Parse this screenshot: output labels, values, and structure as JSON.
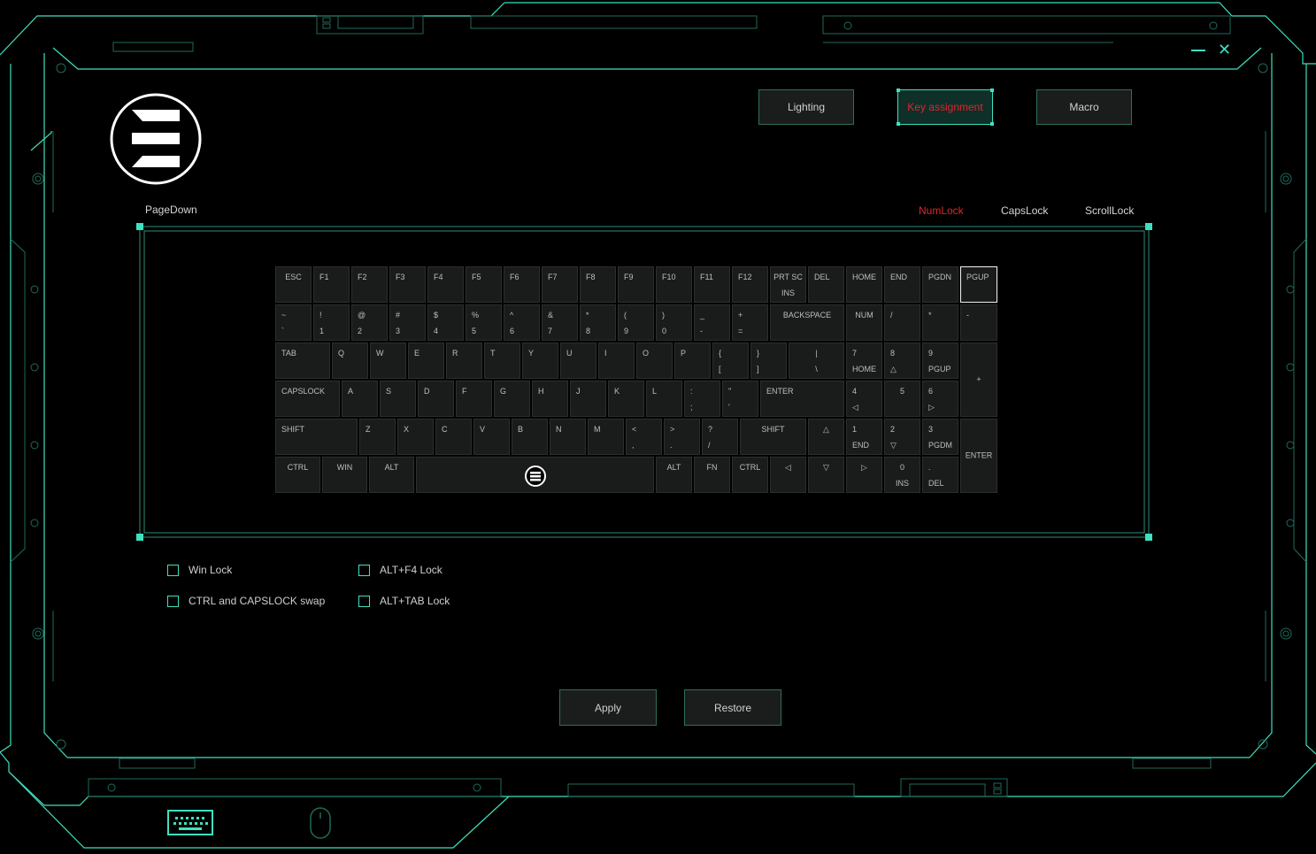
{
  "window": {
    "title": "PageDown",
    "minimize_icon": "minimize-icon",
    "close_icon": "close-icon",
    "accent": "#3fe0bf",
    "alert": "#e0262b"
  },
  "tabs": [
    {
      "label": "Lighting",
      "active": false
    },
    {
      "label": "Key assignment",
      "active": true
    },
    {
      "label": "Macro",
      "active": false
    }
  ],
  "indicators": {
    "numlock": "NumLock",
    "capslock": "CapsLock",
    "scrolllock": "ScrollLock"
  },
  "keyboard": {
    "keys": [
      {
        "id": "esc",
        "top": "ESC"
      },
      {
        "id": "f1",
        "top": "F1"
      },
      {
        "id": "f2",
        "top": "F2"
      },
      {
        "id": "f3",
        "top": "F3"
      },
      {
        "id": "f4",
        "top": "F4"
      },
      {
        "id": "f5",
        "top": "F5"
      },
      {
        "id": "f6",
        "top": "F6"
      },
      {
        "id": "f7",
        "top": "F7"
      },
      {
        "id": "f8",
        "top": "F8"
      },
      {
        "id": "f9",
        "top": "F9"
      },
      {
        "id": "f10",
        "top": "F10"
      },
      {
        "id": "f11",
        "top": "F11"
      },
      {
        "id": "f12",
        "top": "F12"
      },
      {
        "id": "prtsc",
        "top": "PRT SC",
        "bottom": "INS"
      },
      {
        "id": "del",
        "top": "DEL"
      },
      {
        "id": "home",
        "top": "HOME"
      },
      {
        "id": "end",
        "top": "END"
      },
      {
        "id": "pgdn",
        "top": "PGDN"
      },
      {
        "id": "pgup",
        "top": "PGUP"
      },
      {
        "id": "tilde",
        "top": "~",
        "bottom": "`"
      },
      {
        "id": "k1",
        "top": "!",
        "bottom": "1"
      },
      {
        "id": "k2",
        "top": "@",
        "bottom": "2"
      },
      {
        "id": "k3",
        "top": "#",
        "bottom": "3"
      },
      {
        "id": "k4",
        "top": "$",
        "bottom": "4"
      },
      {
        "id": "k5",
        "top": "%",
        "bottom": "5"
      },
      {
        "id": "k6",
        "top": "^",
        "bottom": "6"
      },
      {
        "id": "k7",
        "top": "&",
        "bottom": "7"
      },
      {
        "id": "k8",
        "top": "*",
        "bottom": "8"
      },
      {
        "id": "k9",
        "top": "(",
        "bottom": "9"
      },
      {
        "id": "k0",
        "top": ")",
        "bottom": "0"
      },
      {
        "id": "minus",
        "top": "_",
        "bottom": "-"
      },
      {
        "id": "equal",
        "top": "+",
        "bottom": "="
      },
      {
        "id": "backspace",
        "top": "BACKSPACE"
      },
      {
        "id": "num",
        "top": "NUM"
      },
      {
        "id": "npslash",
        "top": "/"
      },
      {
        "id": "npstar",
        "top": "*"
      },
      {
        "id": "npminus",
        "top": "-"
      },
      {
        "id": "tab",
        "top": "TAB"
      },
      {
        "id": "q",
        "top": "Q"
      },
      {
        "id": "w",
        "top": "W"
      },
      {
        "id": "e",
        "top": "E"
      },
      {
        "id": "r",
        "top": "R"
      },
      {
        "id": "t",
        "top": "T"
      },
      {
        "id": "y",
        "top": "Y"
      },
      {
        "id": "u",
        "top": "U"
      },
      {
        "id": "i",
        "top": "I"
      },
      {
        "id": "o",
        "top": "O"
      },
      {
        "id": "p",
        "top": "P"
      },
      {
        "id": "lbrace",
        "top": "{",
        "bottom": "["
      },
      {
        "id": "rbrace",
        "top": "}",
        "bottom": "]"
      },
      {
        "id": "pipe",
        "top": "|",
        "bottom": "\\"
      },
      {
        "id": "np7",
        "top": "7",
        "bottom": "HOME"
      },
      {
        "id": "np8",
        "top": "8",
        "bottom": "△"
      },
      {
        "id": "np9",
        "top": "9",
        "bottom": "PGUP"
      },
      {
        "id": "npplus",
        "top": "+"
      },
      {
        "id": "capslock",
        "top": "CAPSLOCK"
      },
      {
        "id": "a",
        "top": "A"
      },
      {
        "id": "s",
        "top": "S"
      },
      {
        "id": "d",
        "top": "D"
      },
      {
        "id": "f",
        "top": "F"
      },
      {
        "id": "g",
        "top": "G"
      },
      {
        "id": "h",
        "top": "H"
      },
      {
        "id": "j",
        "top": "J"
      },
      {
        "id": "k",
        "top": "K"
      },
      {
        "id": "l",
        "top": "L"
      },
      {
        "id": "semicolon",
        "top": ":",
        "bottom": ";"
      },
      {
        "id": "quote",
        "top": "\"",
        "bottom": "'"
      },
      {
        "id": "enter",
        "top": "ENTER"
      },
      {
        "id": "np4",
        "top": "4",
        "bottom": "◁"
      },
      {
        "id": "np5",
        "top": "5"
      },
      {
        "id": "np6",
        "top": "6",
        "bottom": "▷"
      },
      {
        "id": "lshift",
        "top": "SHIFT"
      },
      {
        "id": "z",
        "top": "Z"
      },
      {
        "id": "x",
        "top": "X"
      },
      {
        "id": "c",
        "top": "C"
      },
      {
        "id": "v",
        "top": "V"
      },
      {
        "id": "b",
        "top": "B"
      },
      {
        "id": "n",
        "top": "N"
      },
      {
        "id": "m",
        "top": "M"
      },
      {
        "id": "comma",
        "top": "<",
        "bottom": ","
      },
      {
        "id": "period",
        "top": ">",
        "bottom": "."
      },
      {
        "id": "slash",
        "top": "?",
        "bottom": "/"
      },
      {
        "id": "rshift",
        "top": "SHIFT"
      },
      {
        "id": "up",
        "top": "△"
      },
      {
        "id": "np1",
        "top": "1",
        "bottom": "END"
      },
      {
        "id": "np2",
        "top": "2",
        "bottom": "▽"
      },
      {
        "id": "np3",
        "top": "3",
        "bottom": "PGDM"
      },
      {
        "id": "npenter",
        "top": "ENTER"
      },
      {
        "id": "lctrl",
        "top": "CTRL"
      },
      {
        "id": "win",
        "top": "WIN"
      },
      {
        "id": "lalt",
        "top": "ALT"
      },
      {
        "id": "space",
        "top": ""
      },
      {
        "id": "ralt",
        "top": "ALT"
      },
      {
        "id": "fn",
        "top": "FN"
      },
      {
        "id": "rctrl",
        "top": "CTRL"
      },
      {
        "id": "left",
        "top": "◁"
      },
      {
        "id": "down",
        "top": "▽"
      },
      {
        "id": "right",
        "top": "▷"
      },
      {
        "id": "np0",
        "top": "0",
        "bottom": "INS"
      },
      {
        "id": "npdot",
        "top": ".",
        "bottom": "DEL"
      }
    ],
    "selected": "pgup"
  },
  "options": [
    {
      "label": "Win Lock",
      "checked": false
    },
    {
      "label": "CTRL and CAPSLOCK swap",
      "checked": false
    },
    {
      "label": "ALT+F4 Lock",
      "checked": false
    },
    {
      "label": "ALT+TAB Lock",
      "checked": false
    }
  ],
  "actions": {
    "apply": "Apply",
    "restore": "Restore"
  },
  "devices": {
    "keyboard_icon": "keyboard-icon",
    "mouse_icon": "mouse-icon"
  }
}
